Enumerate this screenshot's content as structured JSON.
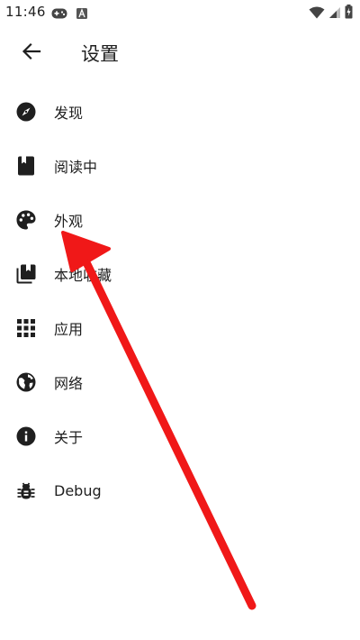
{
  "status_bar": {
    "time": "11:46",
    "left_icons": [
      "gamepad-icon",
      "text-a-icon"
    ],
    "right_icons": [
      "wifi-icon",
      "signal-icon",
      "battery-charging-icon"
    ]
  },
  "app_bar": {
    "title": "设置",
    "back_icon": "arrow-left-icon"
  },
  "menu": {
    "items": [
      {
        "id": "discover",
        "label": "发现",
        "icon": "compass-icon"
      },
      {
        "id": "reading",
        "label": "阅读中",
        "icon": "book-icon"
      },
      {
        "id": "appearance",
        "label": "外观",
        "icon": "palette-icon"
      },
      {
        "id": "local-favorites",
        "label": "本地收藏",
        "icon": "library-icon"
      },
      {
        "id": "apps",
        "label": "应用",
        "icon": "apps-grid-icon"
      },
      {
        "id": "network",
        "label": "网络",
        "icon": "globe-icon"
      },
      {
        "id": "about",
        "label": "关于",
        "icon": "info-icon"
      },
      {
        "id": "debug",
        "label": "Debug",
        "icon": "bug-icon"
      }
    ]
  },
  "annotation": {
    "color": "#f01818"
  },
  "colors": {
    "background": "#ffffff",
    "text": "#1f1f1f",
    "icon": "#1f1f1f"
  }
}
